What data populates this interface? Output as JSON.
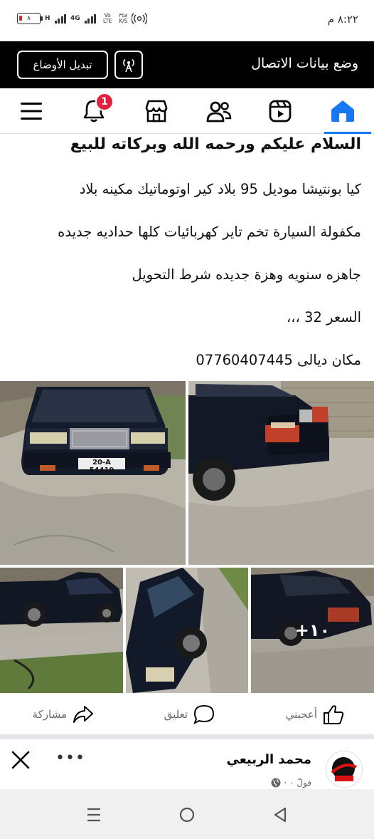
{
  "status_bar": {
    "time": "٨:٢٢ م",
    "battery": "٨",
    "network1": "H",
    "network2": "4G",
    "volte": "Vo LTE",
    "speed_value": "٣٥٨",
    "speed_unit": "K/S",
    "hotspot_count": "2"
  },
  "data_banner": {
    "title": "وضع بيانات الاتصال",
    "switch_label": "تبديل الأوضاع"
  },
  "nav": {
    "notification_count": "1",
    "active_tab": "home",
    "accent": "#1877f2"
  },
  "post": {
    "headline": "السلام عليكم ورحمه الله وبركاته للبيع",
    "lines": [
      "كيا بونتيشا موديل 95 بلاد كير اوتوماتيك مكينه بلاد",
      "مكفولة السيارة تخم تاير كهربائيات كلها حداديه جديده",
      "جاهزه سنويه وهزة جديده شرط التحويل",
      "السعر 32 ،،،",
      "مكان ديالى 07760407445"
    ],
    "plate_text": "20-A 54419",
    "more_photos": "+١٠"
  },
  "actions": {
    "like": "أعجبني",
    "comment": "تعليق",
    "share": "مشاركة"
  },
  "author": {
    "name": "محمد الربيعي",
    "meta": "فولّ ٠ ·"
  }
}
